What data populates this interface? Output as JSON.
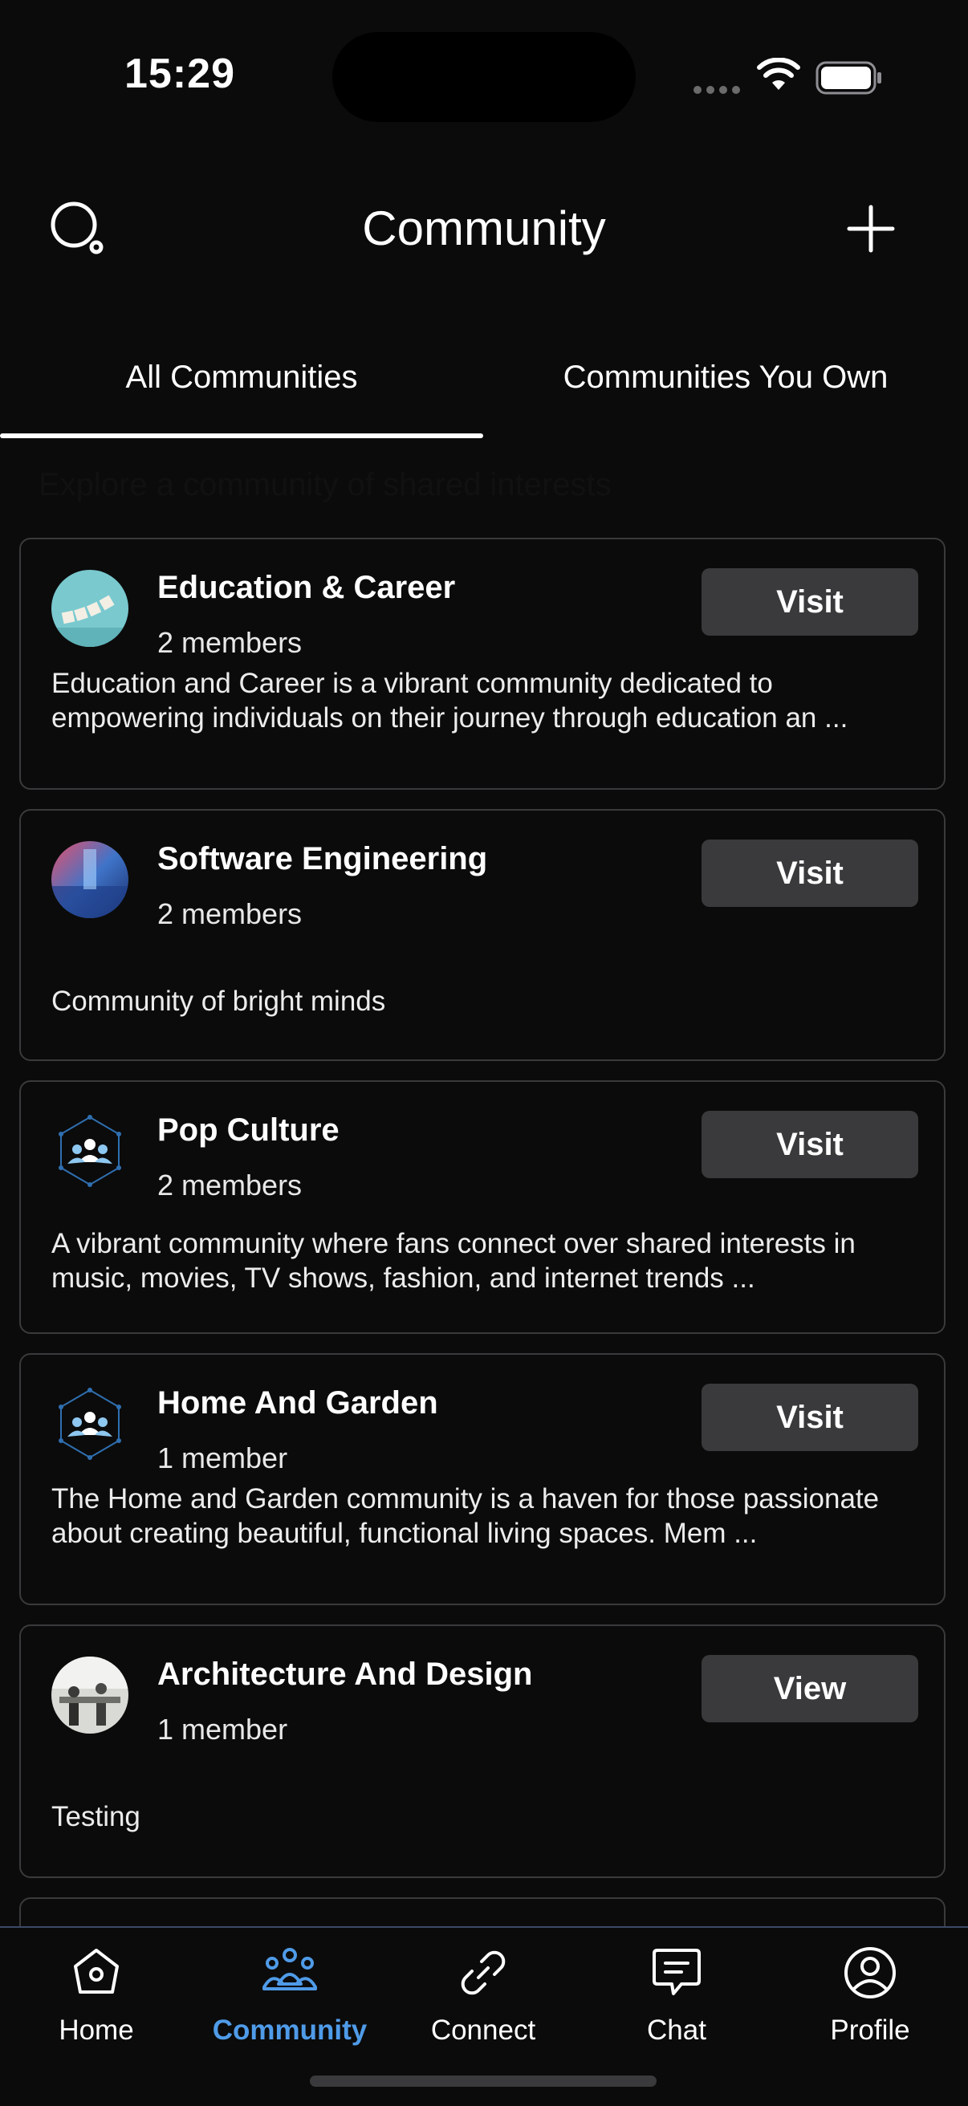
{
  "status_bar": {
    "time": "15:29"
  },
  "header": {
    "title": "Community"
  },
  "tabs": [
    {
      "label": "All Communities",
      "active": true
    },
    {
      "label": "Communities You Own",
      "active": false
    }
  ],
  "subtitle": "Explore a community of shared interests",
  "communities": [
    {
      "name": "Education & Career",
      "members": "2 members",
      "description": "Education and Career is a vibrant community dedicated to empowering individuals on their journey through education an ...",
      "action": "Visit",
      "avatar": "career-photo"
    },
    {
      "name": "Software Engineering",
      "members": "2 members",
      "description": "Community of bright minds",
      "action": "Visit",
      "avatar": "tech-photo"
    },
    {
      "name": "Pop Culture",
      "members": "2 members",
      "description": "A vibrant community where fans connect over shared interests in music, movies, TV shows, fashion, and internet trends ...",
      "action": "Visit",
      "avatar": "community-network-icon"
    },
    {
      "name": "Home And Garden",
      "members": "1 member",
      "description": "The Home and Garden community is a haven for those passionate about creating beautiful, functional living spaces. Mem ...",
      "action": "Visit",
      "avatar": "community-network-icon"
    },
    {
      "name": "Architecture And Design",
      "members": "1 member",
      "description": "Testing",
      "action": "View",
      "avatar": "office-photo"
    }
  ],
  "bottom_nav": [
    {
      "label": "Home",
      "icon": "home-icon",
      "active": false
    },
    {
      "label": "Community",
      "icon": "community-icon",
      "active": true
    },
    {
      "label": "Connect",
      "icon": "link-icon",
      "active": false
    },
    {
      "label": "Chat",
      "icon": "chat-icon",
      "active": false
    },
    {
      "label": "Profile",
      "icon": "profile-icon",
      "active": false
    }
  ],
  "colors": {
    "background": "#0b0b0b",
    "card_border": "#3a3a3c",
    "button_bg": "#3a3a3c",
    "active_nav": "#4f9be8"
  }
}
